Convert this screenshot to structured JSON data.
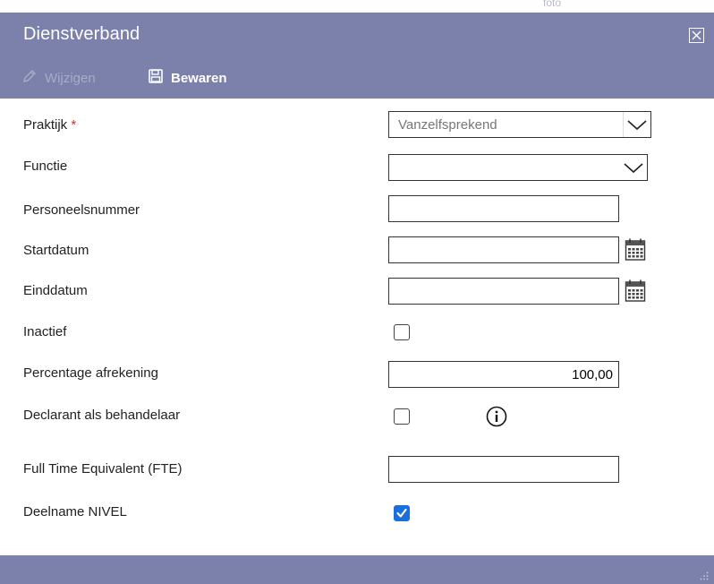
{
  "background": {
    "fragment_text": "foto"
  },
  "dialog": {
    "title": "Dienstverband",
    "toolbar": {
      "edit_label": "Wijzigen",
      "save_label": "Bewaren"
    },
    "fields": {
      "praktijk": {
        "label": "Praktijk",
        "required_mark": "*",
        "value": "Vanzelfsprekend"
      },
      "functie": {
        "label": "Functie",
        "value": ""
      },
      "personeelsnummer": {
        "label": "Personeelsnummer",
        "value": ""
      },
      "startdatum": {
        "label": "Startdatum",
        "value": ""
      },
      "einddatum": {
        "label": "Einddatum",
        "value": ""
      },
      "inactief": {
        "label": "Inactief",
        "checked": false
      },
      "percentage": {
        "label": "Percentage afrekening",
        "value": "100,00"
      },
      "declarant": {
        "label": "Declarant als behandelaar",
        "checked": false
      },
      "fte": {
        "label": "Full Time Equivalent (FTE)",
        "value": ""
      },
      "nivel": {
        "label": "Deelname NIVEL",
        "checked": true
      }
    }
  },
  "colors": {
    "header_bg": "#7c81ab",
    "checkbox_accent": "#1a6fde",
    "required": "#c0392b"
  },
  "icons": [
    "close-icon",
    "pencil-icon",
    "floppy-disk-icon",
    "chevron-down-icon",
    "calendar-icon",
    "info-icon",
    "resize-grip-icon"
  ]
}
